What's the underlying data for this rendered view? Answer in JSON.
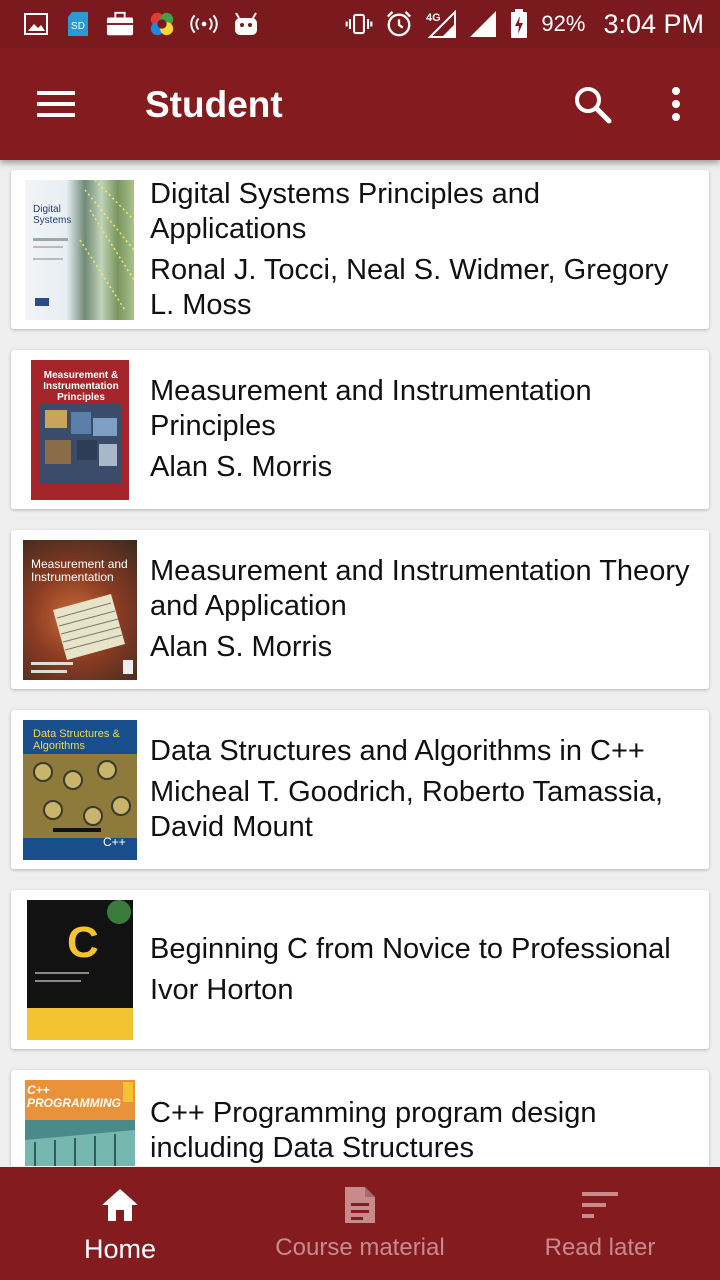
{
  "status_bar": {
    "battery": "92%",
    "time": "3:04 PM",
    "network": "4G",
    "sd_badge": "SD",
    "left_icons": [
      "image-icon",
      "sd-card-icon",
      "briefcase-icon",
      "colorful-app-icon",
      "hotspot-icon",
      "android-icon"
    ],
    "right_icons": [
      "vibrate-icon",
      "alarm-icon",
      "signal-4g-icon",
      "signal-icon",
      "battery-icon"
    ]
  },
  "app_bar": {
    "title": "Student",
    "menu_icon": "hamburger-menu-icon",
    "search_icon": "search-icon",
    "more_icon": "more-vert-icon"
  },
  "books": [
    {
      "title": "Digital Systems Principles and Applications",
      "author": "Ronal J. Tocci, Neal S. Widmer, Gregory L. Moss",
      "cover_text": "Digital Systems"
    },
    {
      "title": "Measurement and Instrumentation Principles",
      "author": "Alan S. Morris",
      "cover_text": "Measurement & Instrumentation Principles"
    },
    {
      "title": "Measurement and Instrumentation Theory and Application",
      "author": "Alan S. Morris",
      "cover_text": "Measurement and Instrumentation"
    },
    {
      "title": "Data Structures and Algorithms in C++",
      "author": "Micheal T. Goodrich, Roberto Tamassia, David Mount",
      "cover_text": "Data Structures & Algorithms"
    },
    {
      "title": "Beginning C from Novice to Professional",
      "author": "Ivor Horton",
      "cover_text": "C"
    },
    {
      "title": "C++ Programming program design including Data Structures",
      "author": "",
      "cover_text": "C++ PROGRAMMING"
    }
  ],
  "bottom_nav": [
    {
      "label": "Home",
      "icon": "home-icon",
      "active": true
    },
    {
      "label": "Course material",
      "icon": "document-icon",
      "active": false
    },
    {
      "label": "Read later",
      "icon": "sort-lines-icon",
      "active": false
    }
  ],
  "colors": {
    "primary": "#841b1f",
    "status_bar": "#7b1a1e",
    "nav_inactive": "#c98a8c",
    "background": "#efefef"
  }
}
